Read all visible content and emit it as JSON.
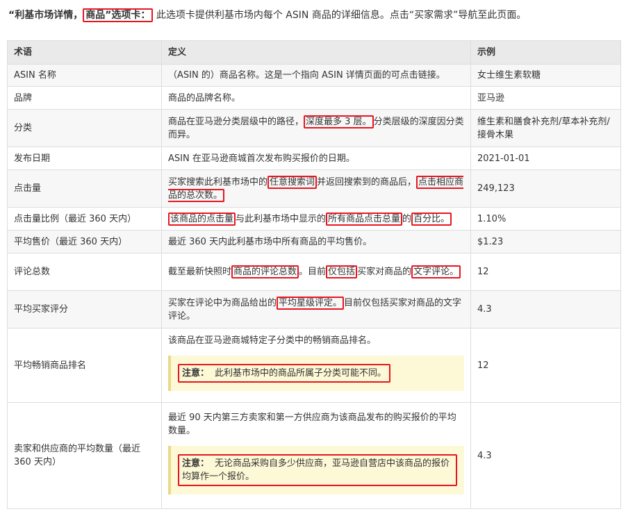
{
  "intro": {
    "title_prefix": "“利基市场详情，",
    "title_highlight": "商品”选项卡：",
    "description": "此选项卡提供利基市场内每个 ASIN 商品的详细信息。点击“买家需求”导航至此页面。"
  },
  "table": {
    "headers": [
      "术语",
      "定义",
      "示例"
    ],
    "rows": {
      "asin": {
        "term": "ASIN 名称",
        "def": "（ASIN 的）商品名称。这是一个指向 ASIN 详情页面的可点击链接。",
        "example": "女士维生素软糖"
      },
      "brand": {
        "term": "品牌",
        "def": "商品的品牌名称。",
        "example": "亚马逊"
      },
      "category": {
        "term": "分类",
        "def_a": "商品在亚马逊分类层级中的路径，",
        "def_hl": "深度最多 3 层。",
        "def_b": "分类层级的深度因分类而异。",
        "example": "维生素和膳食补充剂/草本补充剂/接骨木果"
      },
      "launch": {
        "term": "发布日期",
        "def": "ASIN 在亚马逊商城首次发布购买报价的日期。",
        "example": "2021-01-01"
      },
      "clicks": {
        "term": "点击量",
        "def_a": "买家搜索此利基市场中的",
        "def_hl1": "任意搜索词",
        "def_b": "并返回搜索到的商品后，",
        "def_hl2": "点击相应商品的总次数。",
        "example": "249,123"
      },
      "click_share": {
        "term": "点击量比例（最近 360 天内）",
        "def_hl1": "该商品的点击量",
        "def_a": "与此利基市场中显示的",
        "def_hl2": "所有商品点击总量",
        "def_b": "的",
        "def_hl3": "百分比。",
        "example": "1.10%"
      },
      "avg_price": {
        "term": "平均售价（最近 360 天内）",
        "def": "最近 360 天内此利基市场中所有商品的平均售价。",
        "example": "$1.23"
      },
      "reviews": {
        "term": "评论总数",
        "def_a": "截至最新快照时",
        "def_hl1": "商品的评论总数",
        "def_b": "。目前",
        "def_hl2": "仅包括",
        "def_c": "买家对商品的",
        "def_hl3": "文字评论。",
        "example": "12"
      },
      "rating": {
        "term": "平均买家评分",
        "def_a": "买家在评论中为商品给出的",
        "def_hl": "平均星级评定。",
        "def_b": "目前仅包括买家对商品的文字评论。",
        "example": "4.3"
      },
      "bsr": {
        "term": "平均畅销商品排名",
        "def": "该商品在亚马逊商城特定子分类中的畅销商品排名。",
        "note_label": "注意：",
        "note_text": "此利基市场中的商品所属子分类可能不同。",
        "example": "12"
      },
      "sellers": {
        "term": "卖家和供应商的平均数量（最近 360 天内）",
        "def": "最近 90 天内第三方卖家和第一方供应商为该商品发布的购买报价的平均数量。",
        "note_label": "注意：",
        "note_text": "无论商品采购自多少供应商，亚马逊自营店中该商品的报价均算作一个报价。",
        "example": "4.3"
      }
    }
  }
}
